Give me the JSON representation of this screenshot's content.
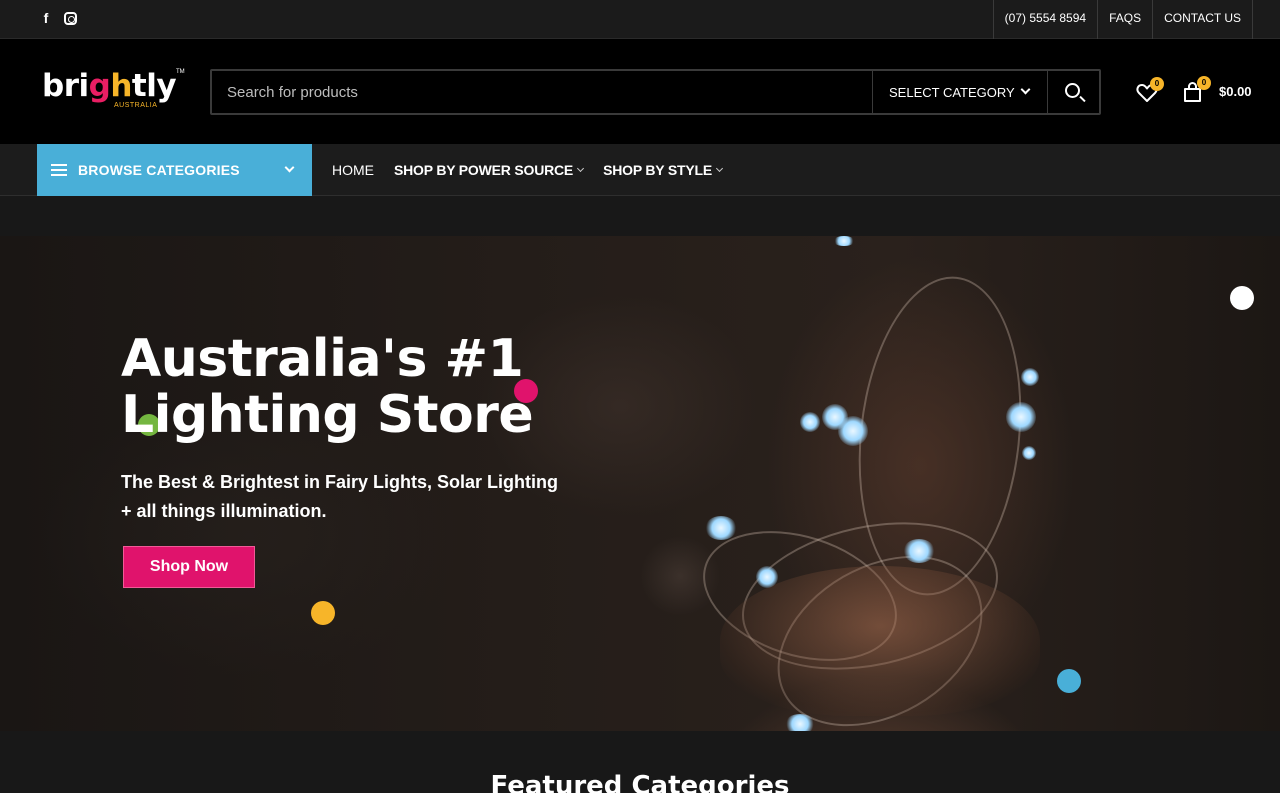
{
  "topbar": {
    "social": [
      {
        "icon": "facebook-icon",
        "glyph": "f"
      },
      {
        "icon": "instagram-icon"
      }
    ],
    "links": [
      "(07) 5554 8594",
      "FAQS",
      "CONTACT US"
    ]
  },
  "header": {
    "logo": {
      "text_a": "bri",
      "text_g": "g",
      "text_h": "h",
      "text_b": "tly",
      "sub": "AUSTRALIA",
      "tm": "TM"
    },
    "search": {
      "placeholder": "Search for products",
      "category": "SELECT CATEGORY"
    },
    "wishlist_count": "0",
    "cart_count": "0",
    "cart_total": "$0.00"
  },
  "nav": {
    "browse_label": "BROWSE CATEGORIES",
    "items": [
      {
        "label": "HOME",
        "dropdown": false
      },
      {
        "label": "SHOP BY POWER SOURCE",
        "dropdown": true
      },
      {
        "label": "SHOP BY STYLE",
        "dropdown": true
      }
    ]
  },
  "hero": {
    "title_line1": "Australia's #1",
    "title_line2": "Lighting Store",
    "subtitle_line1": "The Best & Brightest in Fairy Lights, Solar Lighting",
    "subtitle_line2": "+ all things illumination.",
    "cta": "Shop Now"
  },
  "featured": {
    "title": "Featured Categories"
  },
  "colors": {
    "accent_blue": "#49afd8",
    "accent_pink": "#e0136c",
    "accent_yellow": "#f7b529",
    "dot_green": "#7ec845",
    "dot_white": "#ffffff"
  }
}
